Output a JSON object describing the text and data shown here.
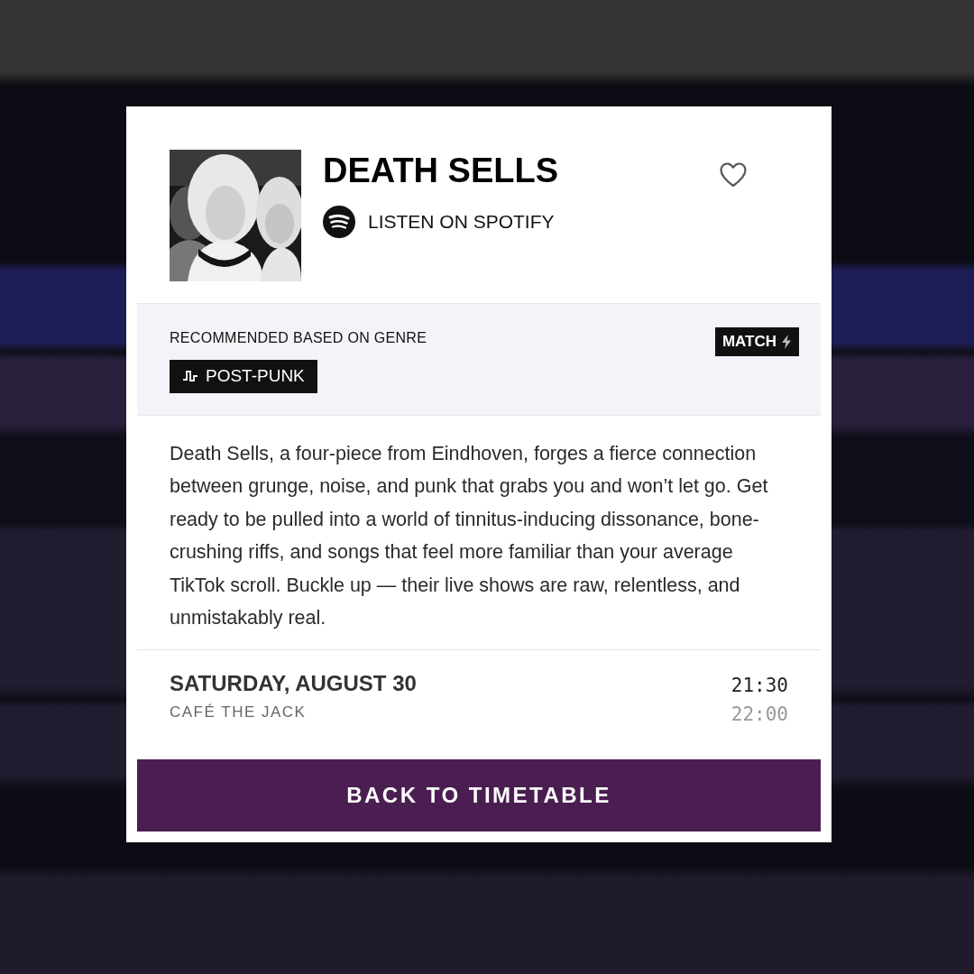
{
  "artist": {
    "name": "DEATH SELLS",
    "spotify_link": "LISTEN ON SPOTIFY",
    "favorite": false
  },
  "recommendation": {
    "label": "RECOMMENDED BASED ON GENRE",
    "genre": "POST-PUNK",
    "badge": "MATCH"
  },
  "description": "Death Sells, a four-piece from Eindhoven, forges a fierce connection between grunge, noise, and punk that grabs you and won’t let go. Get ready to be pulled into a world of tinnitus-inducing dissonance, bone-crushing riffs, and songs that feel more familiar than your average TikTok scroll. Buckle up — their live shows are raw, relentless, and unmistakably real.",
  "performance": {
    "date": "SATURDAY, AUGUST 30",
    "venue": "CAFÉ THE JACK",
    "start": "21:30",
    "end": "22:00"
  },
  "button": "BACK TO TIMETABLE"
}
